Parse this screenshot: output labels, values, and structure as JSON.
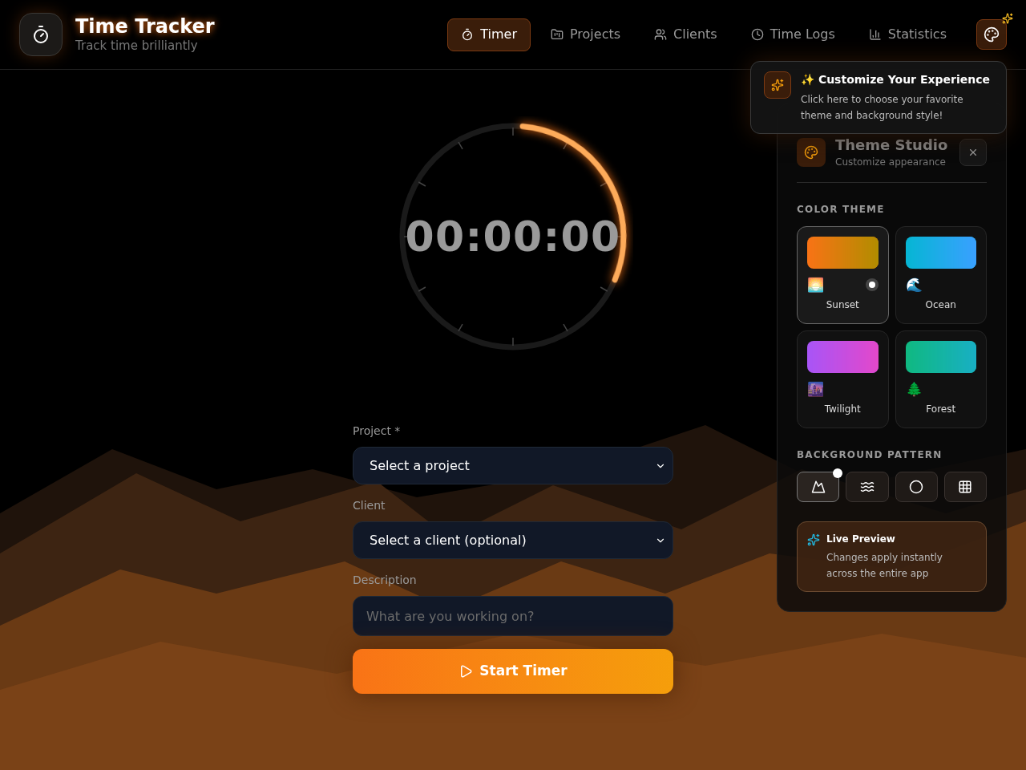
{
  "app": {
    "title": "Time Tracker",
    "subtitle": "Track time brilliantly"
  },
  "nav": [
    {
      "kind": "timer",
      "label": "Timer",
      "selected": true
    },
    {
      "kind": "projects",
      "label": "Projects",
      "selected": false
    },
    {
      "kind": "clients",
      "label": "Clients",
      "selected": false
    },
    {
      "kind": "logs",
      "label": "Time Logs",
      "selected": false
    },
    {
      "kind": "stats",
      "label": "Statistics",
      "selected": false
    }
  ],
  "timer": {
    "display": "00:00:00",
    "level": 0.3
  },
  "form": {
    "project": {
      "label": "Project *",
      "value": "Select a project"
    },
    "client": {
      "label": "Client",
      "value": "Select a client (optional)"
    },
    "description": {
      "label": "Description",
      "placeholder": "What are you working on?"
    },
    "start_button": "Start Timer"
  },
  "tooltip": {
    "emoji": "✨",
    "title": "Customize Your Experience",
    "text": "Click here to choose your favorite theme and background style!"
  },
  "theme_studio": {
    "title": "Theme Studio",
    "subtitle": "Customize appearance",
    "color_theme_heading": "COLOR THEME",
    "themes": [
      {
        "name": "Sunset",
        "emoji": "🌅",
        "color": "#f97316",
        "selected": true
      },
      {
        "name": "Ocean",
        "emoji": "🌊",
        "color": "#06b6d4",
        "selected": false
      },
      {
        "name": "Twilight",
        "emoji": "🌆",
        "color": "#a855f7",
        "selected": false
      },
      {
        "name": "Forest",
        "emoji": "🌲",
        "color": "#10b981",
        "selected": false
      }
    ],
    "pattern_heading": "BACKGROUND PATTERN",
    "patterns": [
      {
        "kind": "mountains",
        "selected": true
      },
      {
        "kind": "waves",
        "selected": false
      },
      {
        "kind": "circle",
        "selected": false
      },
      {
        "kind": "grid",
        "selected": false
      }
    ],
    "live_preview": {
      "title": "Live Preview",
      "text": "Changes apply instantly across the entire app"
    }
  }
}
